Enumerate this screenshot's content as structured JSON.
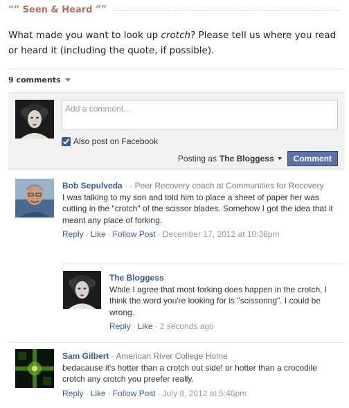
{
  "section": {
    "open_quote": "““",
    "title": "Seen & Heard",
    "close_quote": "””"
  },
  "prompt": {
    "before": "What made you want to look up ",
    "word": "crotch",
    "after": "? Please tell us where you read or heard it (including the quote, if possible)."
  },
  "comments_bar": {
    "count_label": "9 comments"
  },
  "compose": {
    "placeholder": "Add a comment...",
    "facebook_label": "Also post on Facebook",
    "facebook_checked": true,
    "posting_as_label": "Posting as",
    "posting_as_name": "The Bloggess",
    "comment_button": "Comment"
  },
  "comments": [
    {
      "author": "Bob Sepulveda",
      "meta": " · · Peer Recovery coach at Communities for Recovery",
      "text": "I was talking to my son and told him to place a sheet of paper her was cutting in the \"crotch\" of the scissor blades. Somehow I got the idea that it meant any place of forking.",
      "actions": [
        "Reply",
        "Like",
        "Follow Post"
      ],
      "timestamp": "December 17, 2012 at 10:36pm"
    },
    {
      "author": "The Bloggess",
      "meta": "",
      "text": "While I agree that most forking does happen in the crotch, I think the word you're looking for is \"scissoring\". I could be wrong.",
      "actions": [
        "Reply",
        "Like"
      ],
      "timestamp": "2 seconds ago"
    },
    {
      "author": "Sam Gilbert",
      "meta": " · American River College Home",
      "text": "bedacause it's hotter than a crotch out side! or hotter than a crocodile crotch any crotch you preefer really.",
      "actions": [
        "Reply",
        "Like",
        "Follow Post"
      ],
      "timestamp": "July 8, 2012 at 5:46pm"
    }
  ],
  "colors": {
    "link": "#3b5998",
    "section_title": "#b36f5a",
    "button": "#5b74a8"
  },
  "icons": {
    "dropdown": "chevron-down-icon",
    "checkbox": "checkbox-icon"
  }
}
